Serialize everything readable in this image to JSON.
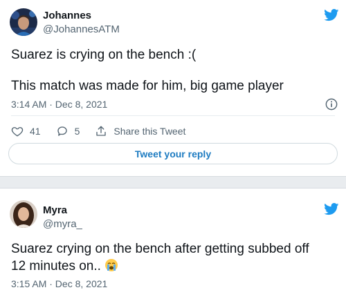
{
  "tweets": [
    {
      "author_name": "Johannes",
      "author_handle": "@JohannesATM",
      "lines": [
        "Suarez is crying on the bench :(",
        "This match was made for him, big game player"
      ],
      "timestamp": "3:14 AM · Dec 8, 2021",
      "likes": "41",
      "replies": "5",
      "share_label": "Share this Tweet",
      "reply_button_label": "Tweet your reply"
    },
    {
      "author_name": "Myra",
      "author_handle": "@myra_",
      "text": "Suarez crying on the bench after getting subbed off 12 minutes on..",
      "emoji": "loudly-crying-face",
      "timestamp": "3:15 AM · Dec 8, 2021"
    }
  ],
  "colors": {
    "brand": "#1d9bf0",
    "link": "#1d7bc1",
    "secondary_text": "#536471",
    "background": "#e9ecef"
  },
  "icons": {
    "logo": "twitter-bird-icon",
    "like": "heart-icon",
    "reply": "speech-bubble-icon",
    "share": "share-icon",
    "info": "info-icon"
  }
}
